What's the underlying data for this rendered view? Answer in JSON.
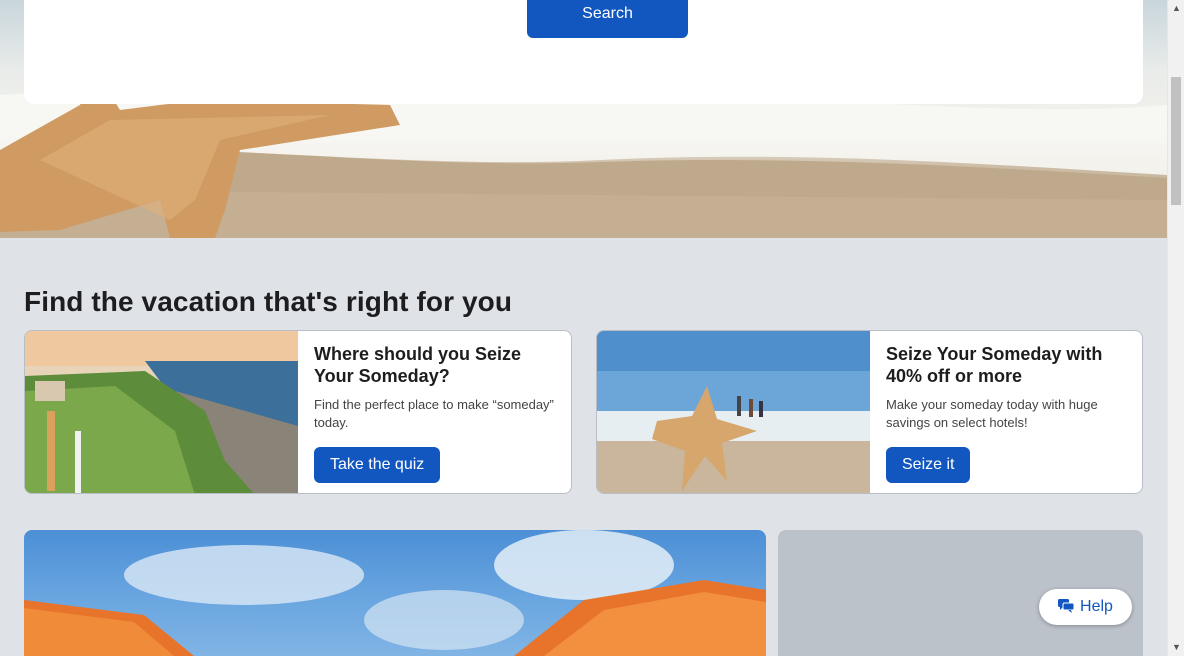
{
  "search": {
    "button_label": "Search"
  },
  "section": {
    "title": "Find the vacation that's right for you"
  },
  "cards": [
    {
      "title": "Where should you Seize Your Someday?",
      "description": "Find the perfect place to make “someday” today.",
      "button_label": "Take the quiz"
    },
    {
      "title": "Seize Your Someday with 40% off or more",
      "description": "Make your someday today with huge savings on select hotels!",
      "button_label": "Seize it"
    }
  ],
  "help": {
    "label": "Help"
  },
  "colors": {
    "accent": "#1257c0",
    "page_bg": "#dfe3e8"
  }
}
